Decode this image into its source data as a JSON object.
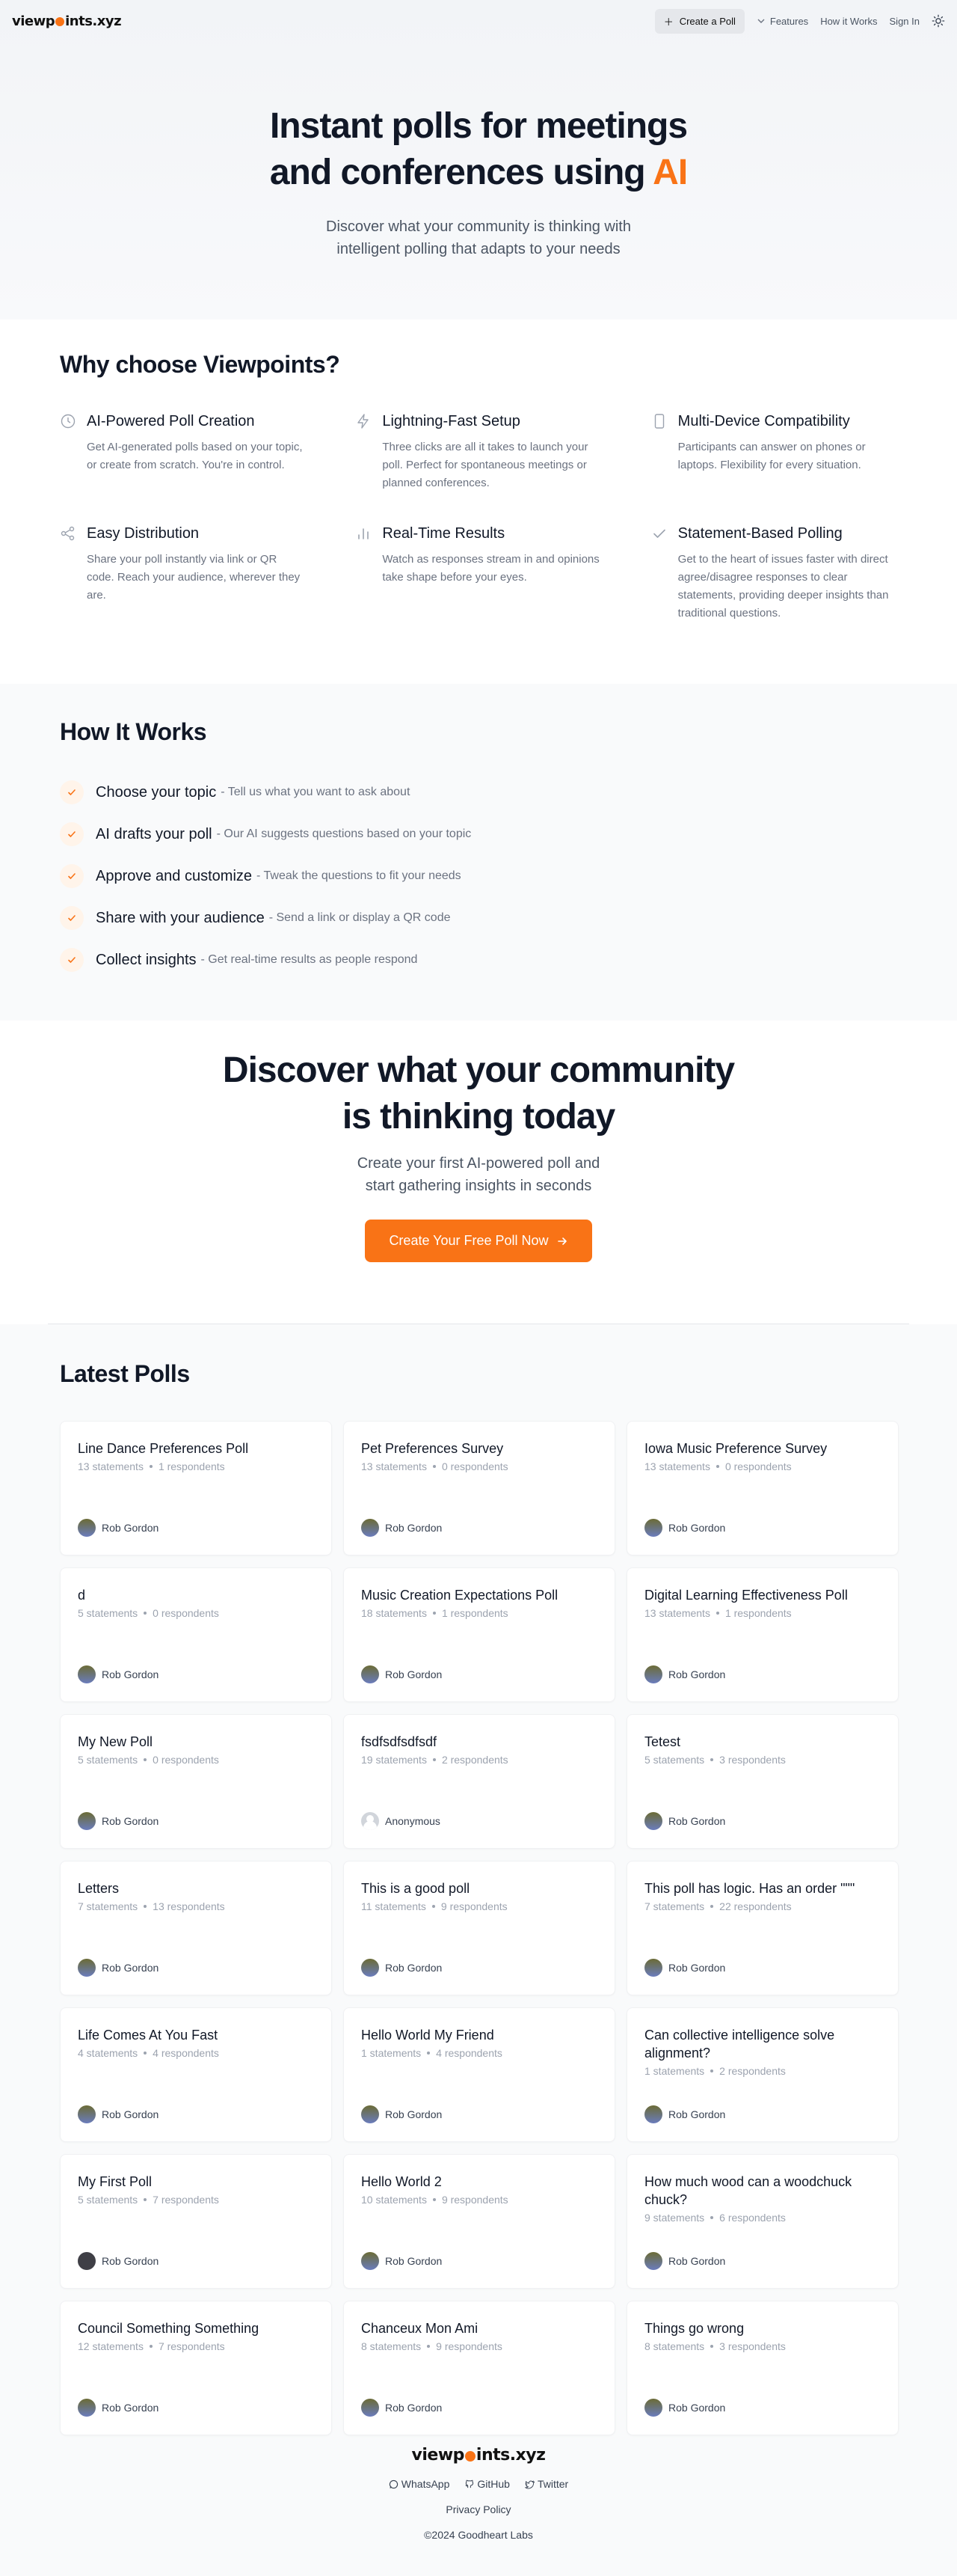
{
  "nav": {
    "logo": {
      "pre": "viewp",
      "post": "ints.xyz"
    },
    "create_label": "Create a Poll",
    "features_label": "Features",
    "how_label": "How it Works",
    "signin_label": "Sign In"
  },
  "hero": {
    "title_line1": "Instant polls for meetings",
    "title_line2_pre": "and conferences using ",
    "title_accent": "AI",
    "subtitle_line1": "Discover what your community is thinking with",
    "subtitle_line2": "intelligent polling that adapts to your needs"
  },
  "why": {
    "title": "Why choose Viewpoints?",
    "features": [
      {
        "icon": "brain-icon",
        "title": "AI-Powered Poll Creation",
        "desc": "Get AI-generated polls based on your topic, or create from scratch. You're in control."
      },
      {
        "icon": "lightning-icon",
        "title": "Lightning-Fast Setup",
        "desc": "Three clicks are all it takes to launch your poll. Perfect for spontaneous meetings or planned conferences."
      },
      {
        "icon": "device-icon",
        "title": "Multi-Device Compatibility",
        "desc": "Participants can answer on phones or laptops. Flexibility for every situation."
      },
      {
        "icon": "share-icon",
        "title": "Easy Distribution",
        "desc": "Share your poll instantly via link or QR code. Reach your audience, wherever they are."
      },
      {
        "icon": "chart-icon",
        "title": "Real-Time Results",
        "desc": "Watch as responses stream in and opinions take shape before your eyes."
      },
      {
        "icon": "check-icon",
        "title": "Statement-Based Polling",
        "desc": "Get to the heart of issues faster with direct agree/disagree responses to clear statements, providing deeper insights than traditional questions."
      }
    ]
  },
  "how": {
    "title": "How It Works",
    "steps": [
      {
        "title": "Choose your topic",
        "desc": "- Tell us what you want to ask about"
      },
      {
        "title": "AI drafts your poll",
        "desc": "- Our AI suggests questions based on your topic"
      },
      {
        "title": "Approve and customize",
        "desc": "- Tweak the questions to fit your needs"
      },
      {
        "title": "Share with your audience",
        "desc": "- Send a link or display a QR code"
      },
      {
        "title": "Collect insights",
        "desc": "- Get real-time results as people respond"
      }
    ]
  },
  "cta": {
    "title_line1": "Discover what your community",
    "title_line2": "is thinking today",
    "subtitle_line1": "Create your first AI-powered poll and",
    "subtitle_line2": "start gathering insights in seconds",
    "button": "Create Your Free Poll Now"
  },
  "latest": {
    "title": "Latest Polls",
    "polls": [
      {
        "title": "Line Dance Preferences Poll",
        "statements": "13 statements",
        "respondents": "1 respondents",
        "author": "Rob Gordon",
        "avatar": "default"
      },
      {
        "title": "Pet Preferences Survey",
        "statements": "13 statements",
        "respondents": "0 respondents",
        "author": "Rob Gordon",
        "avatar": "default"
      },
      {
        "title": "Iowa Music Preference Survey",
        "statements": "13 statements",
        "respondents": "0 respondents",
        "author": "Rob Gordon",
        "avatar": "default"
      },
      {
        "title": "d",
        "statements": "5 statements",
        "respondents": "0 respondents",
        "author": "Rob Gordon",
        "avatar": "default"
      },
      {
        "title": "Music Creation Expectations Poll",
        "statements": "18 statements",
        "respondents": "1 respondents",
        "author": "Rob Gordon",
        "avatar": "default"
      },
      {
        "title": "Digital Learning Effectiveness Poll",
        "statements": "13 statements",
        "respondents": "1 respondents",
        "author": "Rob Gordon",
        "avatar": "default"
      },
      {
        "title": "My New Poll",
        "statements": "5 statements",
        "respondents": "0 respondents",
        "author": "Rob Gordon",
        "avatar": "default"
      },
      {
        "title": "fsdfsdfsdfsdf",
        "statements": "19 statements",
        "respondents": "2 respondents",
        "author": "Anonymous",
        "avatar": "anon"
      },
      {
        "title": "Tetest",
        "statements": "5 statements",
        "respondents": "3 respondents",
        "author": "Rob Gordon",
        "avatar": "default"
      },
      {
        "title": "Letters",
        "statements": "7 statements",
        "respondents": "13 respondents",
        "author": "Rob Gordon",
        "avatar": "default"
      },
      {
        "title": "This is a good poll",
        "statements": "11 statements",
        "respondents": "9 respondents",
        "author": "Rob Gordon",
        "avatar": "default"
      },
      {
        "title": "This poll has logic. Has an order \"\"\"",
        "statements": "7 statements",
        "respondents": "22 respondents",
        "author": "Rob Gordon",
        "avatar": "default"
      },
      {
        "title": "Life Comes At You Fast",
        "statements": "4 statements",
        "respondents": "4 respondents",
        "author": "Rob Gordon",
        "avatar": "default"
      },
      {
        "title": "Hello World My Friend",
        "statements": "1 statements",
        "respondents": "4 respondents",
        "author": "Rob Gordon",
        "avatar": "default"
      },
      {
        "title": "Can collective intelligence solve alignment?",
        "statements": "1 statements",
        "respondents": "2 respondents",
        "author": "Rob Gordon",
        "avatar": "default"
      },
      {
        "title": "My First Poll",
        "statements": "5 statements",
        "respondents": "7 respondents",
        "author": "Rob Gordon",
        "avatar": "dark"
      },
      {
        "title": "Hello World 2",
        "statements": "10 statements",
        "respondents": "9 respondents",
        "author": "Rob Gordon",
        "avatar": "default"
      },
      {
        "title": "How much wood can a woodchuck chuck?",
        "statements": "9 statements",
        "respondents": "6 respondents",
        "author": "Rob Gordon",
        "avatar": "default"
      },
      {
        "title": "Council Something Something",
        "statements": "12 statements",
        "respondents": "7 respondents",
        "author": "Rob Gordon",
        "avatar": "default"
      },
      {
        "title": "Chanceux Mon Ami",
        "statements": "8 statements",
        "respondents": "9 respondents",
        "author": "Rob Gordon",
        "avatar": "default"
      },
      {
        "title": "Things go wrong",
        "statements": "8 statements",
        "respondents": "3 respondents",
        "author": "Rob Gordon",
        "avatar": "default"
      }
    ]
  },
  "footer": {
    "logo": {
      "pre": "viewp",
      "post": "ints.xyz"
    },
    "links": [
      "WhatsApp",
      "GitHub",
      "Twitter"
    ],
    "privacy": "Privacy Policy",
    "copyright": "©2024 Goodheart Labs"
  },
  "colors": {
    "accent": "#f97316",
    "text": "#111827",
    "muted": "#6b7280"
  }
}
